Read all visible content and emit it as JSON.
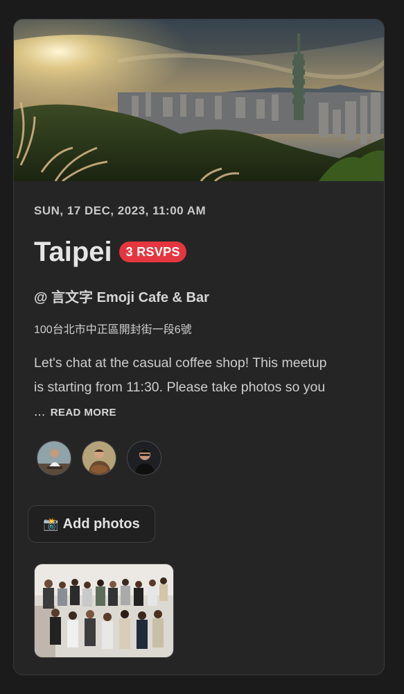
{
  "event": {
    "date": "SUN, 17 DEC, 2023, 11:00 AM",
    "city": "Taipei",
    "rsvp_badge": "3 RSVPS",
    "venue": "@ 言文字 Emoji Cafe & Bar",
    "address": "100台北市中正區開封街一段6號",
    "description": "Let's chat at the casual coffee shop! This meetup is starting from 11:30. Please take photos so you ...",
    "read_more": "READ MORE",
    "add_photos_label": "Add photos",
    "add_photos_icon": "📸"
  },
  "attendees": [
    {
      "icon": "attendee-avatar-1"
    },
    {
      "icon": "attendee-avatar-2"
    },
    {
      "icon": "attendee-avatar-3"
    }
  ],
  "colors": {
    "badge": "#e5363f",
    "card_bg": "#252526",
    "page_bg": "#1b1b1c"
  }
}
